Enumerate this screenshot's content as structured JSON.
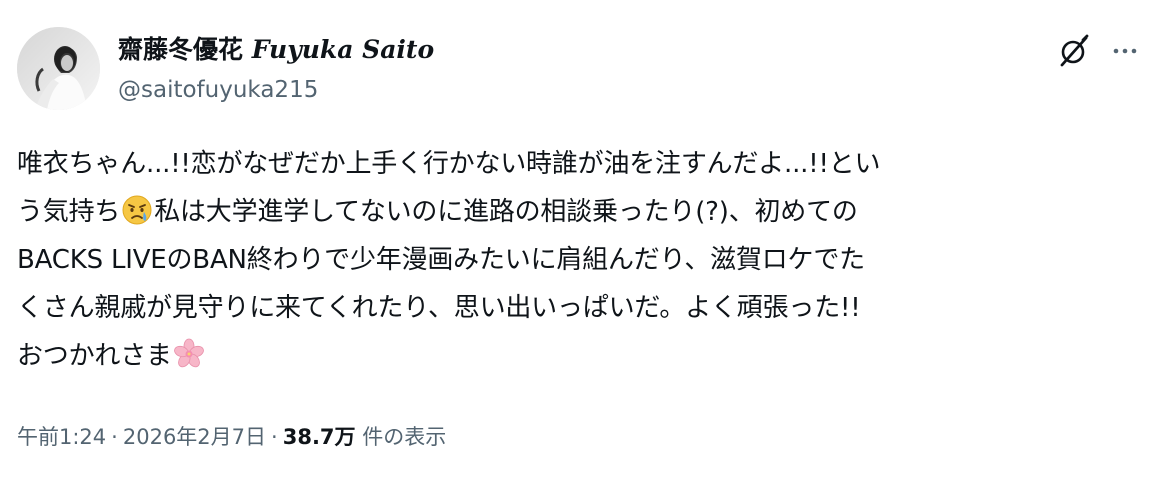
{
  "author": {
    "display_name_ja": "齋藤冬優花",
    "display_name_latin": "Fuyuka Saito",
    "handle": "@saitofuyuka215"
  },
  "tweet": {
    "lines": [
      "唯衣ちゃん...!!恋がなぜだか上手く行かない時誰が油を注すんだよ...!!とい",
      "う気持ち",
      "私は大学進学してないのに進路の相談乗ったり(?)、初めての",
      "BACKS LIVEのBAN終わりで少年漫画みたいに肩組んだり、滋賀ロケでた",
      "くさん親戚が見守りに来てくれたり、思い出いっぱいだ。よく頑張った!!",
      "おつかれさま"
    ]
  },
  "meta": {
    "time": "午前1:24",
    "separator": "·",
    "date": "2026年2月7日",
    "views_count": "38.7万",
    "views_label": "件の表示"
  },
  "icons": {
    "grok": "grok-icon",
    "more": "more-dots-icon",
    "crying_emoji": "crying-face-icon",
    "blossom_emoji": "cherry-blossom-icon"
  }
}
